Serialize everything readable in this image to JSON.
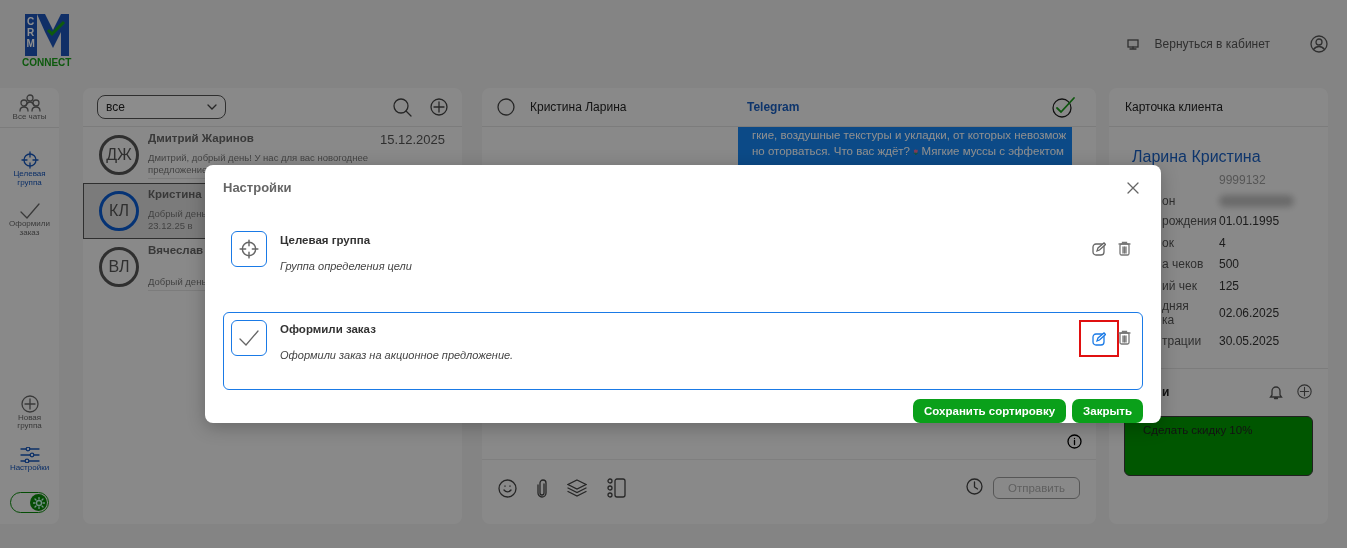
{
  "header": {
    "logo": {
      "letters": "CRM",
      "wordmark": "CONNECT"
    },
    "back_link": "Вернуться в кабинет"
  },
  "rail": {
    "items": [
      {
        "label": "Все чаты",
        "kind": "all",
        "selected": false
      },
      {
        "label": "Целевая группа",
        "kind": "target",
        "selected": true
      },
      {
        "label": "Оформили заказ",
        "kind": "check",
        "selected": false
      }
    ],
    "bottom": [
      {
        "label": "Новая группа",
        "kind": "plus",
        "selected": false
      },
      {
        "label": "Настройки",
        "kind": "settings",
        "selected": true
      }
    ],
    "theme_toggle": {
      "on": true
    }
  },
  "chat_list": {
    "filter": "все",
    "items": [
      {
        "initials": "ДЖ",
        "name": "Дмитрий Жаринов",
        "date": "15.12.2025",
        "preview": [
          "Дмитрий, добрый день! У нас для вас новогоднее",
          "предложение"
        ],
        "selected": false
      },
      {
        "initials": "КЛ",
        "name": "Кристина",
        "preview": [
          "Добрый день",
          "23.12.25 в"
        ],
        "selected": true
      },
      {
        "initials": "ВЛ",
        "name": "Вячеслав",
        "preview": [
          "Добрый день"
        ],
        "selected": false
      }
    ]
  },
  "chat": {
    "contact": "Кристина Ларина",
    "channel": "Telegram",
    "message_lines": [
      [
        {
          "kind": "text",
          "text": "гкие, воздушные текстуры и укладки, от которых невозмож"
        }
      ],
      [
        {
          "kind": "text",
          "text": "но оторваться. Что вас ждёт?"
        },
        {
          "kind": "tulip"
        },
        {
          "kind": "text",
          "text": "Мягкие муссы с эффектом"
        }
      ]
    ],
    "send_button": "Отправить"
  },
  "client_card": {
    "title": "Карточка клиента",
    "name": "Ларина Кристина",
    "fields": [
      {
        "kind": "plain",
        "value": "9999132",
        "muted": true
      },
      {
        "kind": "redacted",
        "label": "он"
      },
      {
        "kind": "plain",
        "label": "рождения",
        "value": "01.01.1995",
        "muted": false
      },
      {
        "kind": "plain",
        "label": "ок",
        "value": "4",
        "muted": false
      },
      {
        "kind": "plain",
        "label": "а чеков",
        "value": "500",
        "muted": false
      },
      {
        "kind": "plain",
        "label": "ий чек",
        "value": "125",
        "muted": false
      },
      {
        "kind": "plain",
        "label": "дняя\nка",
        "value": "02.06.2025",
        "muted": false
      },
      {
        "kind": "plain",
        "label": "трации",
        "value": "30.05.2025",
        "muted": false
      }
    ]
  },
  "tasks": {
    "title_fragment": "и",
    "notes": [
      {
        "text": "Сделать скидку 10%"
      }
    ]
  },
  "modal": {
    "title": "Настройки",
    "groups": [
      {
        "kind": "target",
        "title": "Целевая группа",
        "description": "Группа определения цели",
        "selected": false,
        "edit_highlighted": false
      },
      {
        "kind": "check",
        "title": "Оформили заказ",
        "description": "Оформили заказ на акционное предложение.",
        "selected": true,
        "edit_highlighted": true
      }
    ],
    "buttons": [
      "Сохранить сортировку",
      "Закрыть"
    ]
  }
}
